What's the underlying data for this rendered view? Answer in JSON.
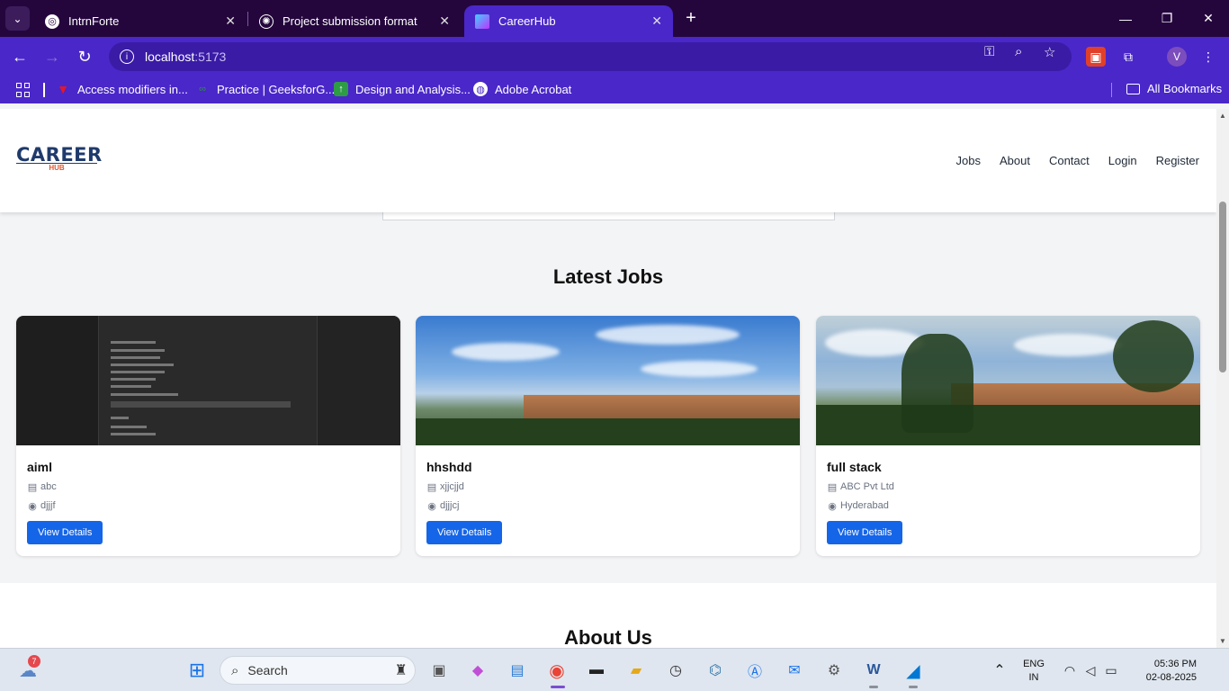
{
  "browser": {
    "tabs": [
      {
        "title": "IntrnForte",
        "active": false
      },
      {
        "title": "Project submission format",
        "active": false
      },
      {
        "title": "CareerHub",
        "active": true
      }
    ],
    "url_host": "localhost",
    "url_port": ":5173",
    "profile_initial": "V",
    "bookmarks": [
      {
        "label": "Access modifiers in..."
      },
      {
        "label": "Practice | GeeksforG..."
      },
      {
        "label": "Design and Analysis..."
      },
      {
        "label": "Adobe Acrobat"
      }
    ],
    "all_bookmarks_label": "All Bookmarks"
  },
  "site": {
    "logo_text": "CAREER",
    "logo_sub": "HUB",
    "nav": [
      "Jobs",
      "About",
      "Contact",
      "Login",
      "Register"
    ],
    "latest_jobs_title": "Latest Jobs",
    "about_title": "About Us",
    "jobs": [
      {
        "title": "aiml",
        "company": "abc",
        "location": "djjjf",
        "button": "View Details"
      },
      {
        "title": "hhshdd",
        "company": "xjjcjjd",
        "location": "djjjcj",
        "button": "View Details"
      },
      {
        "title": "full stack",
        "company": "ABC Pvt Ltd",
        "location": "Hyderabad",
        "button": "View Details"
      }
    ]
  },
  "taskbar": {
    "weather_badge": "7",
    "search_placeholder": "Search",
    "language": "ENG",
    "region": "IN",
    "time": "05:36 PM",
    "date": "02-08-2025"
  }
}
